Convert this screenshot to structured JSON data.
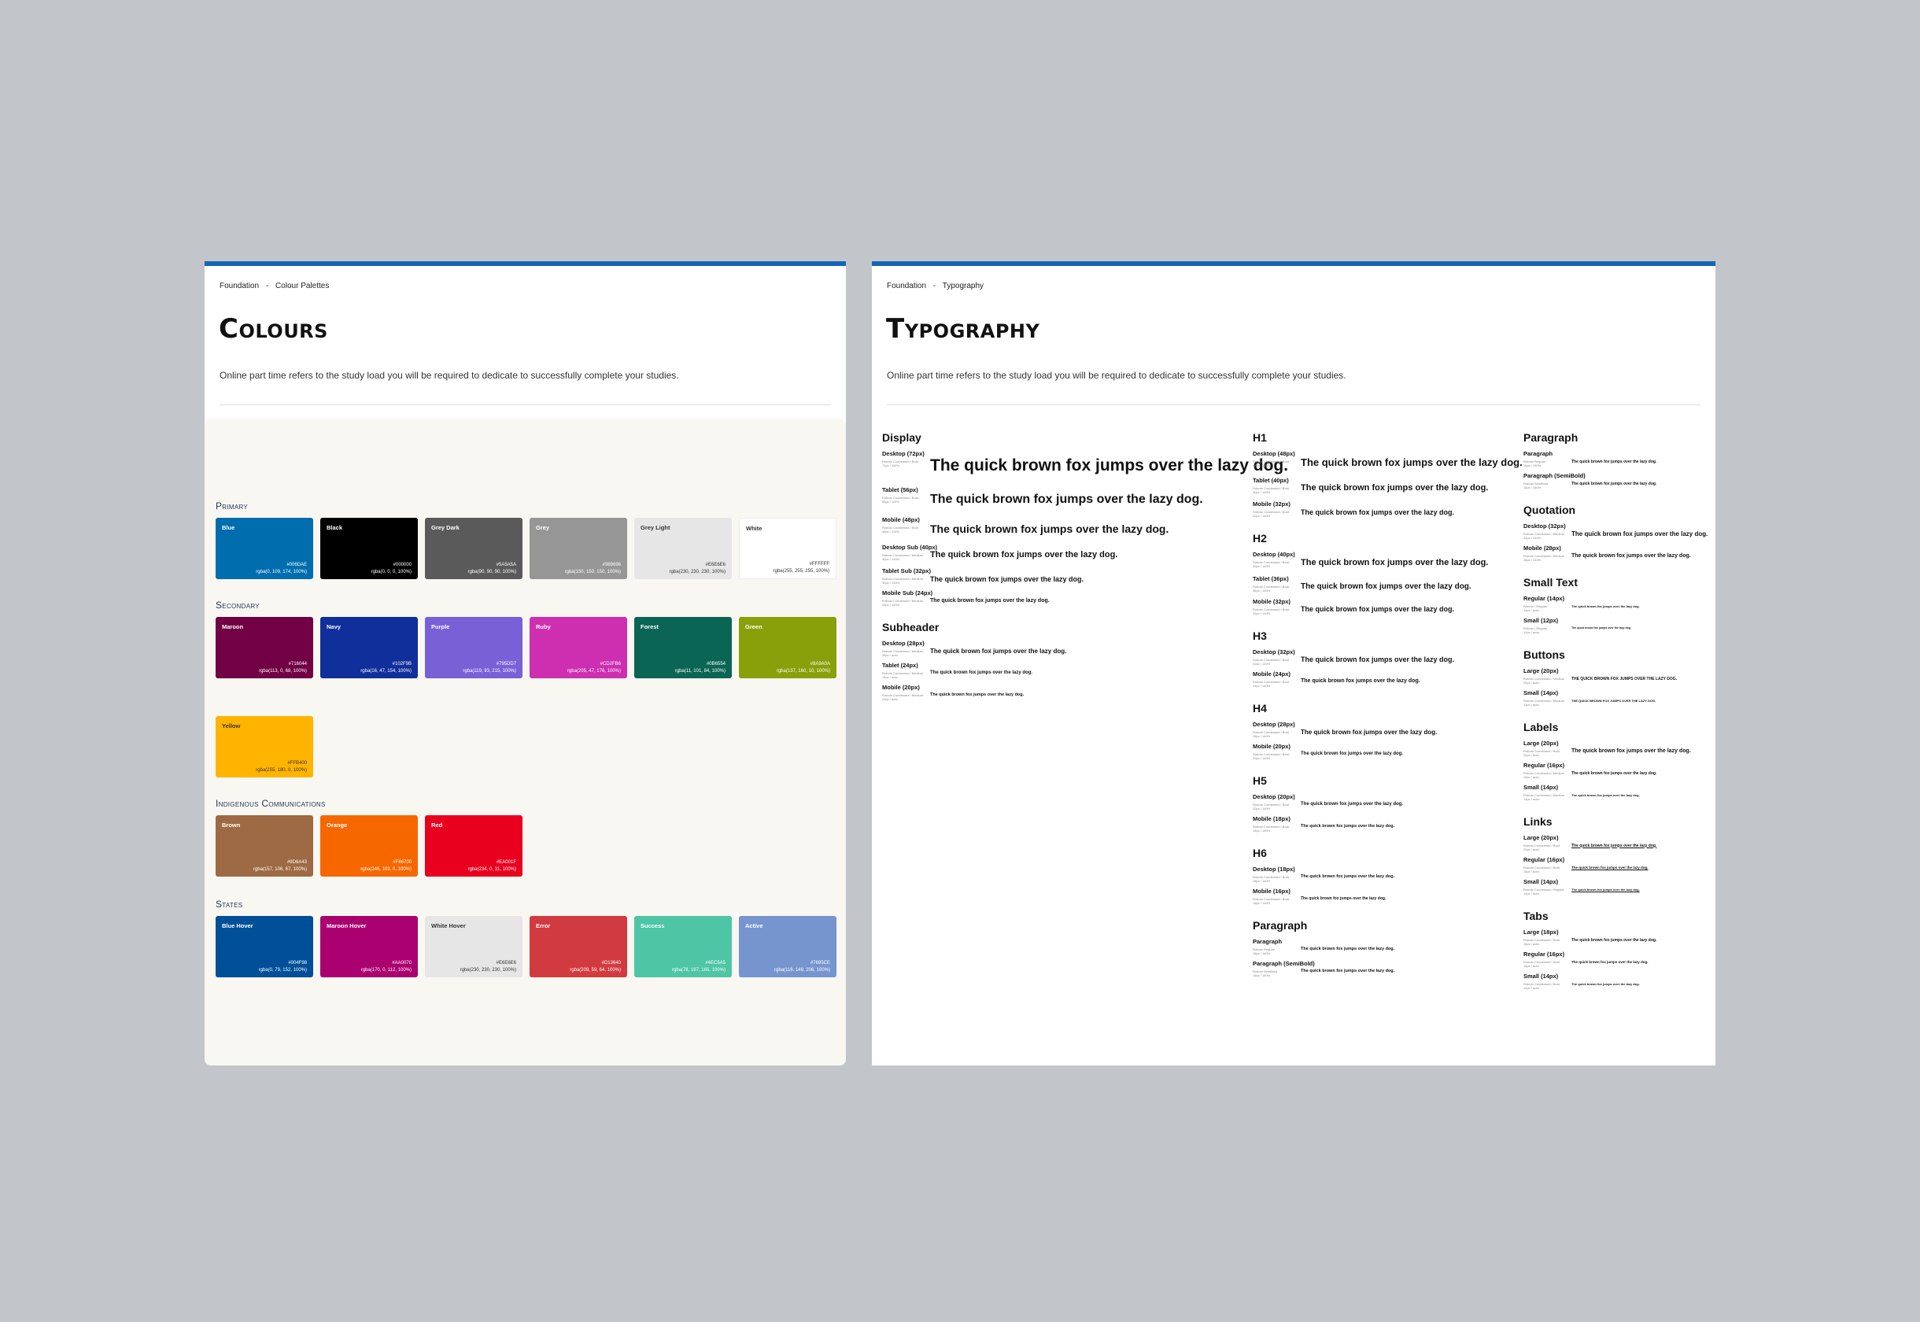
{
  "colours_page": {
    "breadcrumb": [
      "Foundation",
      "-",
      "Colour Palettes"
    ],
    "title": "Colours",
    "description": "Online part time refers to the study load you will be required to dedicate to successfully complete your studies.",
    "sections": [
      {
        "title": "Primary",
        "swatches": [
          {
            "name": "Blue",
            "hex": "#006DAE",
            "rgba": "rgba(0, 109, 174, 100%)",
            "color": "#006dae",
            "tone": "dark"
          },
          {
            "name": "Black",
            "hex": "#000000",
            "rgba": "rgba(0, 0, 0, 100%)",
            "color": "#000000",
            "tone": "dark"
          },
          {
            "name": "Grey Dark",
            "hex": "#5A5A5A",
            "rgba": "rgba(90, 90, 90, 100%)",
            "color": "#5a5a5a",
            "tone": "dark"
          },
          {
            "name": "Grey",
            "hex": "#969696",
            "rgba": "rgba(150, 150, 150, 100%)",
            "color": "#969696",
            "tone": "dark"
          },
          {
            "name": "Grey Light",
            "hex": "#E6E6E6",
            "rgba": "rgba(230, 230, 230, 100%)",
            "color": "#e6e6e6",
            "tone": "light"
          },
          {
            "name": "White",
            "hex": "#FFFFFF",
            "rgba": "rgba(255, 255, 255, 100%)",
            "color": "#ffffff",
            "tone": "light"
          }
        ]
      },
      {
        "title": "Secondary",
        "swatches": [
          {
            "name": "Maroon",
            "hex": "#716044",
            "rgba": "rgba(113, 0, 68, 100%)",
            "color": "#710044",
            "tone": "dark"
          },
          {
            "name": "Navy",
            "hex": "#102F9B",
            "rgba": "rgba(16, 47, 154, 100%)",
            "color": "#102f9a",
            "tone": "dark"
          },
          {
            "name": "Purple",
            "hex": "#795DD7",
            "rgba": "rgba(119, 93, 215, 100%)",
            "color": "#7860d7",
            "tone": "dark"
          },
          {
            "name": "Ruby",
            "hex": "#CD2FB6",
            "rgba": "rgba(205, 47, 176, 100%)",
            "color": "#cd2fb0",
            "tone": "dark"
          },
          {
            "name": "Forest",
            "hex": "#0B6554",
            "rgba": "rgba(11, 101, 84, 100%)",
            "color": "#0b6554",
            "tone": "dark"
          },
          {
            "name": "Green",
            "hex": "#8A9A0A",
            "rgba": "rgba(137, 160, 10, 100%)",
            "color": "#89a00a",
            "tone": "dark"
          },
          {
            "name": "Yellow",
            "hex": "#FFB400",
            "rgba": "rgba(255, 180, 0, 100%)",
            "color": "#ffb400",
            "tone": "light"
          }
        ]
      },
      {
        "title": "Indigenous Communications",
        "swatches": [
          {
            "name": "Brown",
            "hex": "#9D6A43",
            "rgba": "rgba(157, 106, 67, 100%)",
            "color": "#9d6a43",
            "tone": "dark"
          },
          {
            "name": "Orange",
            "hex": "#F66700",
            "rgba": "rgba(246, 103, 0, 100%)",
            "color": "#f66700",
            "tone": "dark"
          },
          {
            "name": "Red",
            "hex": "#EA001F",
            "rgba": "rgba(234, 0, 31, 100%)",
            "color": "#ea001f",
            "tone": "dark"
          }
        ]
      },
      {
        "title": "States",
        "swatches": [
          {
            "name": "Blue Hover",
            "hex": "#004F98",
            "rgba": "rgba(0, 79, 152, 100%)",
            "color": "#004f98",
            "tone": "dark"
          },
          {
            "name": "Maroon Hover",
            "hex": "#AA0070",
            "rgba": "rgba(170, 0, 112, 100%)",
            "color": "#aa0070",
            "tone": "dark"
          },
          {
            "name": "White Hover",
            "hex": "#E6E6E6",
            "rgba": "rgba(230, 230, 230, 100%)",
            "color": "#e6e6e6",
            "tone": "light"
          },
          {
            "name": "Error",
            "hex": "#D13640",
            "rgba": "rgba(209, 59, 64, 100%)",
            "color": "#d13b40",
            "tone": "dark"
          },
          {
            "name": "Success",
            "hex": "#4EC5A5",
            "rgba": "rgba(78, 197, 165, 100%)",
            "color": "#4ec5a5",
            "tone": "dark"
          },
          {
            "name": "Active",
            "hex": "#7695CE",
            "rgba": "rgba(118, 149, 206, 100%)",
            "color": "#7695ce",
            "tone": "dark"
          }
        ]
      }
    ]
  },
  "typography_page": {
    "breadcrumb": [
      "Foundation",
      "-",
      "Typography"
    ],
    "title": "Typography",
    "description": "Online part time refers to the study load you will be required to dedicate to successfully complete your studies.",
    "sample_text": "The quick brown fox jumps over the lazy dog.",
    "sample_caps": "THE QUICK BROWN FOX JUMPS OVER THE LAZY DOG.",
    "columns": [
      [
        {
          "heading": "Display",
          "rows": [
            {
              "label": "Desktop (72px)",
              "meta": [
                "Roboto Condensed / Bold",
                "72px / 110%"
              ],
              "size": 21
            },
            {
              "label": "Tablet (56px)",
              "meta": [
                "Roboto Condensed / Bold",
                "56px / 110%"
              ],
              "size": 16
            },
            {
              "label": "Mobile (48px)",
              "meta": [
                "Roboto Condensed / Bold",
                "48px / 110%"
              ],
              "size": 14
            },
            {
              "label": "Desktop Sub (40px)",
              "meta": [
                "Roboto Condensed / Medium",
                "40px / 140%"
              ],
              "size": 11
            },
            {
              "label": "Tablet Sub (32px)",
              "meta": [
                "Roboto Condensed / Medium",
                "32px / 140%"
              ],
              "size": 9
            },
            {
              "label": "Mobile Sub (24px)",
              "meta": [
                "Roboto Condensed / Medium",
                "24px / 140%"
              ],
              "size": 7
            }
          ]
        },
        {
          "heading": "Subheader",
          "rows": [
            {
              "label": "Desktop (28px)",
              "meta": [
                "Roboto Condensed / Medium",
                "28px / auto"
              ],
              "size": 8
            },
            {
              "label": "Tablet (24px)",
              "meta": [
                "Roboto Condensed / Medium",
                "24px / auto"
              ],
              "size": 6
            },
            {
              "label": "Mobile (20px)",
              "meta": [
                "Roboto Condensed / Medium",
                "20px / auto"
              ],
              "size": 5.5
            }
          ]
        }
      ],
      [
        {
          "heading": "H1",
          "rows": [
            {
              "label": "Desktop (48px)",
              "meta": [
                "Roboto Condensed / Bold",
                "48px / 140%"
              ],
              "size": 13
            },
            {
              "label": "Tablet (40px)",
              "meta": [
                "Roboto Condensed / Bold",
                "40px / 140%"
              ],
              "size": 11
            },
            {
              "label": "Mobile (32px)",
              "meta": [
                "Roboto Condensed / Bold",
                "32px / 140%"
              ],
              "size": 9
            }
          ]
        },
        {
          "heading": "H2",
          "rows": [
            {
              "label": "Desktop (40px)",
              "meta": [
                "Roboto Condensed / Bold",
                "40px / 140%"
              ],
              "size": 11
            },
            {
              "label": "Tablet (36px)",
              "meta": [
                "Roboto Condensed / Bold",
                "36px / 140%"
              ],
              "size": 10
            },
            {
              "label": "Mobile (32px)",
              "meta": [
                "Roboto Condensed / Bold",
                "32px / 140%"
              ],
              "size": 9
            }
          ]
        },
        {
          "heading": "H3",
          "rows": [
            {
              "label": "Desktop (32px)",
              "meta": [
                "Roboto Condensed / Bold",
                "32px / 140%"
              ],
              "size": 9
            },
            {
              "label": "Mobile (24px)",
              "meta": [
                "Roboto Condensed / Bold",
                "24px / 140%"
              ],
              "size": 7
            }
          ]
        },
        {
          "heading": "H4",
          "rows": [
            {
              "label": "Desktop (28px)",
              "meta": [
                "Roboto Condensed / Bold",
                "28px / 140%"
              ],
              "size": 8
            },
            {
              "label": "Mobile (20px)",
              "meta": [
                "Roboto Condensed / Bold",
                "20px / 140%"
              ],
              "size": 6
            }
          ]
        },
        {
          "heading": "H5",
          "rows": [
            {
              "label": "Desktop (20px)",
              "meta": [
                "Roboto Condensed / Bold",
                "20px / 140%"
              ],
              "size": 6
            },
            {
              "label": "Mobile (18px)",
              "meta": [
                "Roboto Condensed / Bold",
                "18px / 140%"
              ],
              "size": 5.5
            }
          ]
        },
        {
          "heading": "H6",
          "rows": [
            {
              "label": "Desktop (18px)",
              "meta": [
                "Roboto Condensed / Bold",
                "18px / 140%"
              ],
              "size": 5.5
            },
            {
              "label": "Mobile (16px)",
              "meta": [
                "Roboto Condensed / Bold",
                "16px / 140%"
              ],
              "size": 5
            }
          ]
        },
        {
          "heading": "Paragraph",
          "rows": [
            {
              "label": "Paragraph",
              "meta": [
                "Roboto Regular",
                "16px / 160%"
              ],
              "size": 5.5
            },
            {
              "label": "Paragraph (SemiBold)",
              "meta": [
                "Roboto SemiBold",
                "16px / 160%"
              ],
              "size": 5.5
            }
          ]
        }
      ],
      [
        {
          "heading": "Paragraph",
          "rows": [
            {
              "label": "Paragraph",
              "meta": [
                "Roboto Regular",
                "16px / 160%"
              ],
              "size": 5
            },
            {
              "label": "Paragraph (SemiBold)",
              "meta": [
                "Roboto SemiBold",
                "16px / 160%"
              ],
              "size": 5
            }
          ]
        },
        {
          "heading": "Quotation",
          "rows": [
            {
              "label": "Desktop (32px)",
              "meta": [
                "Roboto Condensed / Medium",
                "32px / 140%"
              ],
              "size": 8
            },
            {
              "label": "Mobile (28px)",
              "meta": [
                "Roboto Condensed / Medium",
                "28px / 140%"
              ],
              "size": 7
            }
          ]
        },
        {
          "heading": "Small Text",
          "rows": [
            {
              "label": "Regular (14px)",
              "meta": [
                "Roboto / Regular",
                "14px / auto"
              ],
              "size": 4
            },
            {
              "label": "Small (12px)",
              "meta": [
                "Roboto / Regular",
                "12px / auto"
              ],
              "size": 3.5
            }
          ]
        },
        {
          "heading": "Buttons",
          "rows": [
            {
              "label": "Large (20px)",
              "meta": [
                "Roboto Condensed / Medium",
                "20px / auto"
              ],
              "size": 5,
              "caps": true
            },
            {
              "label": "Small (14px)",
              "meta": [
                "Roboto Condensed / Medium",
                "14px / auto"
              ],
              "size": 4,
              "caps": true
            }
          ]
        },
        {
          "heading": "Labels",
          "rows": [
            {
              "label": "Large (20px)",
              "meta": [
                "Roboto Condensed / Bold",
                "20px / auto"
              ],
              "size": 7
            },
            {
              "label": "Regular (16px)",
              "meta": [
                "Roboto Condensed / Medium",
                "16px / auto"
              ],
              "size": 5
            },
            {
              "label": "Small (14px)",
              "meta": [
                "Roboto Condensed / Medium",
                "14px / auto"
              ],
              "size": 4
            }
          ]
        },
        {
          "heading": "Links",
          "rows": [
            {
              "label": "Large (20px)",
              "meta": [
                "Roboto Condensed / Bold",
                "20px / auto"
              ],
              "size": 5,
              "underline": true
            },
            {
              "label": "Regular (16px)",
              "meta": [
                "Roboto Condensed / Bold",
                "16px / auto"
              ],
              "size": 4.5,
              "underline": true
            },
            {
              "label": "Small (14px)",
              "meta": [
                "Roboto Condensed / Regular",
                "14px / auto"
              ],
              "size": 4,
              "underline": true
            }
          ]
        },
        {
          "heading": "Tabs",
          "rows": [
            {
              "label": "Large (18px)",
              "meta": [
                "Roboto Condensed / Bold",
                "18px / auto"
              ],
              "size": 5
            },
            {
              "label": "Regular (16px)",
              "meta": [
                "Roboto Condensed / Bold",
                "16px / auto"
              ],
              "size": 4.5
            },
            {
              "label": "Small (14px)",
              "meta": [
                "Roboto Condensed / Bold",
                "14px / auto"
              ],
              "size": 4
            }
          ]
        }
      ]
    ]
  }
}
